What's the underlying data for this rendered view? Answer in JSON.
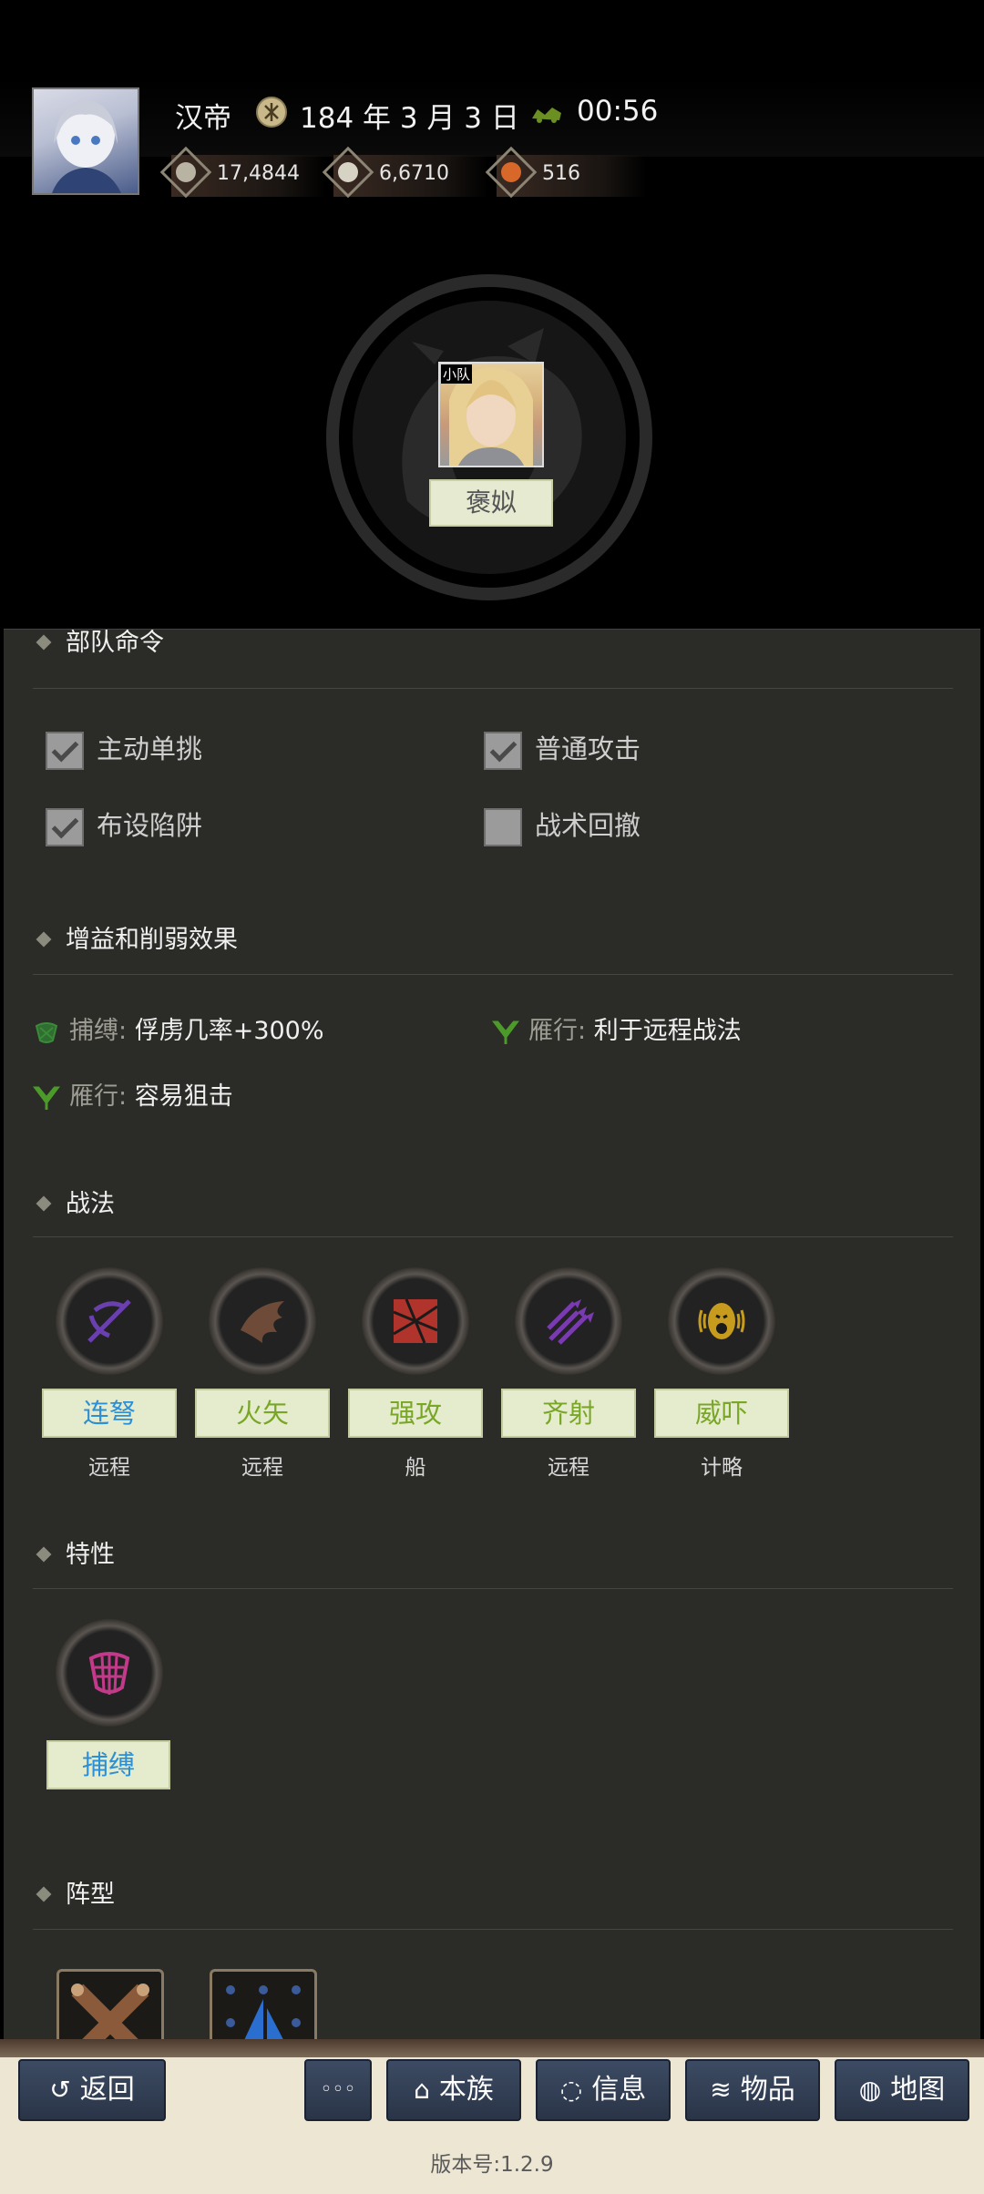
{
  "header": {
    "ruler": "汉帝",
    "date": "184 年 3 月 3 日",
    "time": "00:56",
    "resources": [
      {
        "icon": "silver-coin-icon",
        "value": "17,4844"
      },
      {
        "icon": "grain-icon",
        "value": "6,6710"
      },
      {
        "icon": "medal-icon",
        "value": "516"
      }
    ]
  },
  "hero": {
    "tag": "小队",
    "name": "褒姒"
  },
  "panel": {
    "commands_title": "部队命令",
    "checks": [
      {
        "label": "主动单挑",
        "checked": true
      },
      {
        "label": "普通攻击",
        "checked": true
      },
      {
        "label": "布设陷阱",
        "checked": true
      },
      {
        "label": "战术回撤",
        "checked": false
      }
    ],
    "effects_title": "增益和削弱效果",
    "effects": [
      {
        "key": "捕缚:",
        "value": "俘虏几率+300%"
      },
      {
        "key": "雁行:",
        "value": "利于远程战法"
      },
      {
        "key": "雁行:",
        "value": "容易狙击"
      }
    ],
    "tactics_title": "战法",
    "tactics": [
      {
        "name": "连弩",
        "type": "远程",
        "color": "#2d8fd6"
      },
      {
        "name": "火矢",
        "type": "远程",
        "color": "#7aa628"
      },
      {
        "name": "强攻",
        "type": "船",
        "color": "#7aa628"
      },
      {
        "name": "齐射",
        "type": "远程",
        "color": "#7aa628"
      },
      {
        "name": "威吓",
        "type": "计略",
        "color": "#7aa628"
      }
    ],
    "traits_title": "特性",
    "traits": [
      {
        "name": "捕缚",
        "color": "#2d8fd6"
      }
    ],
    "formation_title": "阵型"
  },
  "bottom": {
    "back": "返回",
    "more": "◦◦◦",
    "clan": "本族",
    "info": "信息",
    "items": "物品",
    "map": "地图",
    "version": "版本号:1.2.9"
  }
}
